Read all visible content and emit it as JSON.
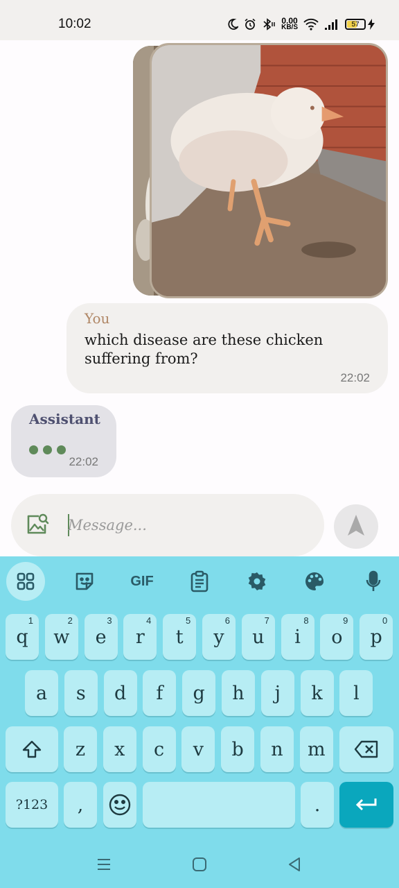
{
  "status_bar": {
    "time": "10:02",
    "net_speed_value": "0.00",
    "net_speed_unit": "KB/S",
    "battery_level": "57",
    "icons": [
      "moon-icon",
      "alarm-icon",
      "bluetooth-icon",
      "wifi-icon",
      "signal-icon",
      "battery-icon",
      "charging-icon"
    ]
  },
  "chat": {
    "attached_images": [
      "chicken-photo-1",
      "chicken-photo-2"
    ],
    "user_message": {
      "sender": "You",
      "text": "which disease are these chicken suffering from?",
      "time": "22:02"
    },
    "assistant_message": {
      "sender": "Assistant",
      "time": "22:02",
      "typing": true
    }
  },
  "composer": {
    "placeholder": "Message...",
    "value": ""
  },
  "keyboard": {
    "toolbar": [
      "apps-icon",
      "sticker-icon",
      "GIF",
      "clipboard-icon",
      "settings-icon",
      "palette-icon",
      "mic-icon"
    ],
    "gif_label": "GIF",
    "row1": [
      {
        "k": "q",
        "n": "1"
      },
      {
        "k": "w",
        "n": "2"
      },
      {
        "k": "e",
        "n": "3"
      },
      {
        "k": "r",
        "n": "4"
      },
      {
        "k": "t",
        "n": "5"
      },
      {
        "k": "y",
        "n": "6"
      },
      {
        "k": "u",
        "n": "7"
      },
      {
        "k": "i",
        "n": "8"
      },
      {
        "k": "o",
        "n": "9"
      },
      {
        "k": "p",
        "n": "0"
      }
    ],
    "row2": [
      "a",
      "s",
      "d",
      "f",
      "g",
      "h",
      "j",
      "k",
      "l"
    ],
    "row3": [
      "z",
      "x",
      "c",
      "v",
      "b",
      "n",
      "m"
    ],
    "symbols_label": "?123",
    "comma_label": ",",
    "period_label": ".",
    "accent_color": "#0aa7bd",
    "background_color": "#7fdceb"
  },
  "nav_bar": {
    "icons": [
      "menu-icon",
      "home-icon",
      "back-icon"
    ]
  }
}
